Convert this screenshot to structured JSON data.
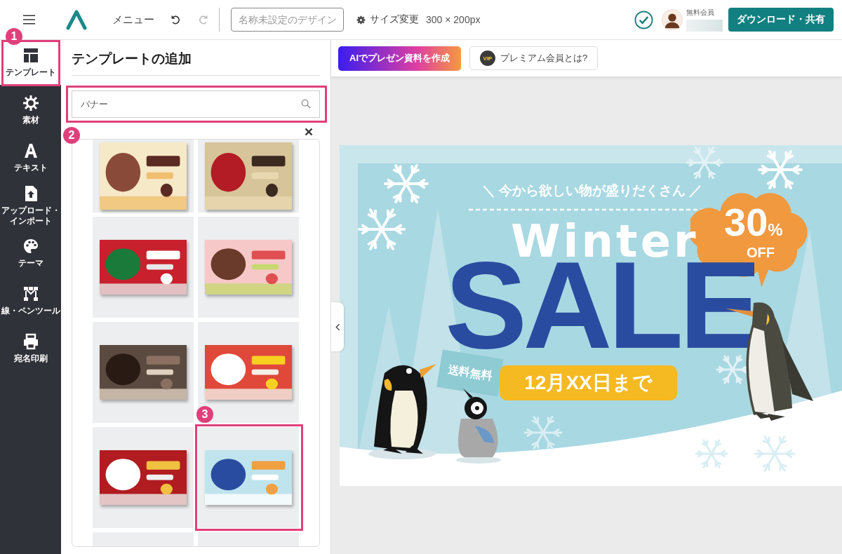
{
  "header": {
    "menu_label": "メニュー",
    "design_name_placeholder": "名称未設定のデザイン",
    "resize_label": "サイズ変更",
    "size": "300 × 200px",
    "saved": true,
    "member_label": "無料会員",
    "download_button": "ダウンロード・共有"
  },
  "sidebar": {
    "items": [
      {
        "kind": "template",
        "label": "テンプレート",
        "selected": true,
        "callout": "1"
      },
      {
        "kind": "material",
        "label": "素材",
        "selected": false
      },
      {
        "kind": "text",
        "label": "テキスト",
        "selected": false
      },
      {
        "kind": "upload",
        "label": "アップロード・インポート",
        "selected": false
      },
      {
        "kind": "theme",
        "label": "テーマ",
        "selected": false
      },
      {
        "kind": "pen",
        "label": "線・ペンツール",
        "selected": false
      },
      {
        "kind": "print",
        "label": "宛名印刷",
        "selected": false
      }
    ]
  },
  "panel": {
    "title": "テンプレートの追加",
    "search": {
      "value": "バナー",
      "callout": "2"
    },
    "templates": [
      {
        "kind": "picture"
      },
      {
        "kind": "picture"
      },
      {
        "kind": "picture"
      },
      {
        "kind": "picture"
      },
      {
        "kind": "picture"
      },
      {
        "kind": "picture"
      },
      {
        "kind": "picture"
      },
      {
        "kind": "picture",
        "callout": "3"
      },
      {
        "kind": "cut_off"
      },
      {
        "kind": "cut_off"
      }
    ]
  },
  "toolbar": {
    "ai_button": "AIでプレゼン資料を作成",
    "vip_badge": "VIP",
    "premium_button": "プレミアム会員とは?"
  },
  "banner": {
    "tagline": "＼ 今から欲しい物が盛りだくさん ／",
    "script_word": "Winter",
    "headline": "SALE",
    "discount_value": "30",
    "discount_unit": "%",
    "discount_note": "OFF",
    "sign": "送料無料",
    "deadline": "12月XX日まで"
  }
}
